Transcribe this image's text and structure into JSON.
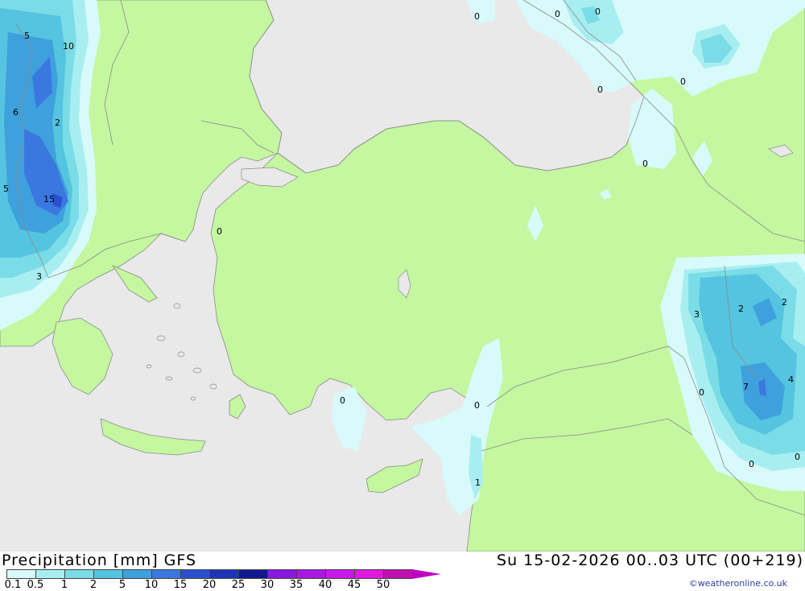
{
  "map": {
    "colors": {
      "sea": "#e9e9e9",
      "land": "#c4f7a0",
      "border": "#8a8a8a",
      "p01": "#d8fafa",
      "p05": "#a8eef0",
      "p1": "#7adce6",
      "p2": "#54c4e0",
      "p5": "#3ea0dc",
      "p10": "#3a78e0",
      "p15": "#2a50d0"
    },
    "values": [
      "5",
      "10",
      "6",
      "2",
      "5",
      "15",
      "3",
      "0",
      "0",
      "0",
      "0",
      "0",
      "0",
      "0",
      "0",
      "0",
      "0",
      "1",
      "3",
      "2",
      "2",
      "7",
      "4",
      "0",
      "0",
      "0"
    ]
  },
  "footer": {
    "title": "Precipitation [mm] GFS",
    "time": "Su 15-02-2026 00..03 UTC (00+219)",
    "credit": "©weatheronline.co.uk"
  },
  "legend": {
    "labels": [
      "0.1",
      "0.5",
      "1",
      "2",
      "5",
      "10",
      "15",
      "20",
      "25",
      "30",
      "35",
      "40",
      "45",
      "50"
    ],
    "colors": [
      "#d8fafa",
      "#a8eef0",
      "#7adce6",
      "#54c4e0",
      "#3ea0dc",
      "#3a78e0",
      "#2a50d0",
      "#1c34b8",
      "#101890",
      "#8a18e0",
      "#a818e0",
      "#c818e8",
      "#e018e0",
      "#c010b0"
    ],
    "arrow_color": "#c000c0"
  }
}
